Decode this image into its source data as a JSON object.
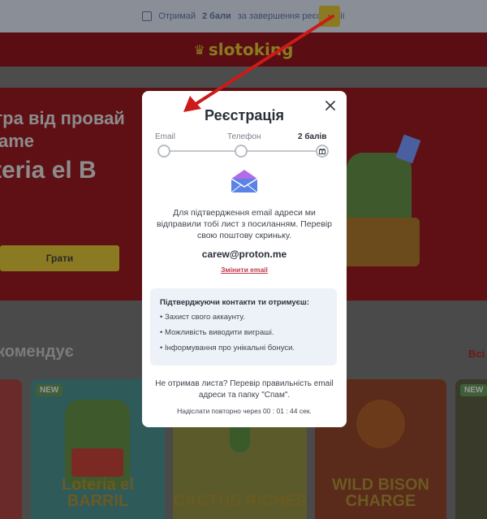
{
  "topbar": {
    "text_before": "Отримай",
    "points": "2 бали",
    "text_after": "за завершення реєстрації"
  },
  "header": {
    "logo": "slotoking"
  },
  "hero": {
    "line1": "гра від провай",
    "line2": "ame",
    "line3": "teria el B",
    "play_label": "Грати"
  },
  "section": {
    "title": "комендує",
    "all_label": "Всі"
  },
  "games": [
    {
      "badge": "NEW",
      "title": "Loteria el BARRIL"
    },
    {
      "badge": "",
      "title": "CACTUS RICHES"
    },
    {
      "badge": "",
      "title": "WILD BISON CHARGE"
    },
    {
      "badge": "NEW",
      "title": ""
    }
  ],
  "modal": {
    "title": "Реєстрація",
    "steps": {
      "email": "Email",
      "phone": "Телефон",
      "points": "2 балів"
    },
    "confirm_text": "Для підтвердження email адреси ми відправили тобі лист з посиланням. Перевір свою поштову скриньку.",
    "email": "carew@proton.me",
    "change_email": "Змінити email",
    "benefits": {
      "title": "Підтверджуючи контакти ти отримуєш:",
      "items": [
        "• Захист свого аккаунту.",
        "• Можливість виводити виграші.",
        "• Інформування про унікальні бонуси."
      ]
    },
    "not_received": "Не отримав листа? Перевір правильність email адреси та папку \"Спам\".",
    "resend_text": "Надіслати повторно через",
    "resend_timer": "00 : 01 : 44 сек."
  },
  "colors": {
    "accent_gold": "#f6d94a",
    "brand_red": "#c8202a",
    "link_red": "#c23a4a",
    "arrow": "#cc1a1a"
  }
}
